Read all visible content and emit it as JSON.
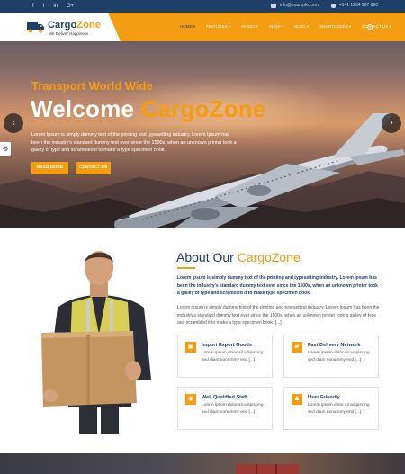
{
  "topbar": {
    "social_icons": [
      "facebook-icon",
      "twitter-icon",
      "linkedin-icon",
      "google-plus-icon"
    ],
    "social_glyphs": [
      "f",
      "t",
      "in",
      "G+"
    ],
    "email": "info@example.com",
    "phone": "+141 1234 567 890"
  },
  "header": {
    "logo_name_main": "Cargo",
    "logo_name_accent": "Zone",
    "logo_tagline": "We Deliver Happiness",
    "nav": [
      {
        "label": "HOME ▾",
        "active": true
      },
      {
        "label": "FEATURES ▾",
        "active": false
      },
      {
        "label": "PAGES ▾",
        "active": false
      },
      {
        "label": "SHOP ▾",
        "active": false
      },
      {
        "label": "BLOG ▾",
        "active": false
      },
      {
        "label": "SHORTCODES ▾",
        "active": false
      },
      {
        "label": "CONTACT US ▾",
        "active": false
      }
    ]
  },
  "hero": {
    "subtitle": "Transport World Wide",
    "title_main": "Welcome ",
    "title_accent": "CargoZone",
    "text": "Lorem Ipsum is simply dummy text of the printing and typesetting industry. Lorem Ipsum has been the industry's standard dummy text ever since the 1500s, when an unknown printer took a galley of type and scrambled it to make a type specimen book.",
    "read_more": "READ MORE",
    "contact_us": "CONTACT US",
    "prev_arrow": "‹",
    "next_arrow": "›",
    "settings_glyph": "⚙"
  },
  "about": {
    "title_main": "About Our ",
    "title_accent": "CargoZone",
    "p1": "Lorem ipsum is simply dummy text of the printing and typesetting industry. Lorem Ipsum has been the industry's standard dummy text ever since the 1500s, when an unknown printer took a galley of type and scrambled it to make type specimen book.",
    "p2": "Lorem ipsum is simply dummy text of the printing and typesetting industry. Lorem Ipsum has been the industry's standard dummy text ever since the 1500s, when an unknown printer took a galley of type and scrambled it to make a type specimen book. [...]",
    "cards": [
      {
        "icon": "box-icon",
        "glyph": "▣",
        "title": "Import Export Goods",
        "text": "Lorem ipsum dolor sit adipiscing sed diam nonummy end [...]"
      },
      {
        "icon": "truck-icon",
        "glyph": "▰",
        "title": "Fast Delivery Network",
        "text": "Lorem ipsum dolor sit adipiscing sed diam nonummy end [...]"
      },
      {
        "icon": "location-icon",
        "glyph": "◉",
        "title": "Well Qualified Staff",
        "text": "Lorem ipsum dolor sit adipiscing sed diam nonummy end [...]"
      },
      {
        "icon": "user-icon",
        "glyph": "♟",
        "title": "User Friendly",
        "text": "Lorem ipsum dolor sit adipiscing sed diam nonummy end [...]"
      }
    ]
  },
  "colors": {
    "accent": "#f59d12",
    "navy": "#1f3f66"
  }
}
